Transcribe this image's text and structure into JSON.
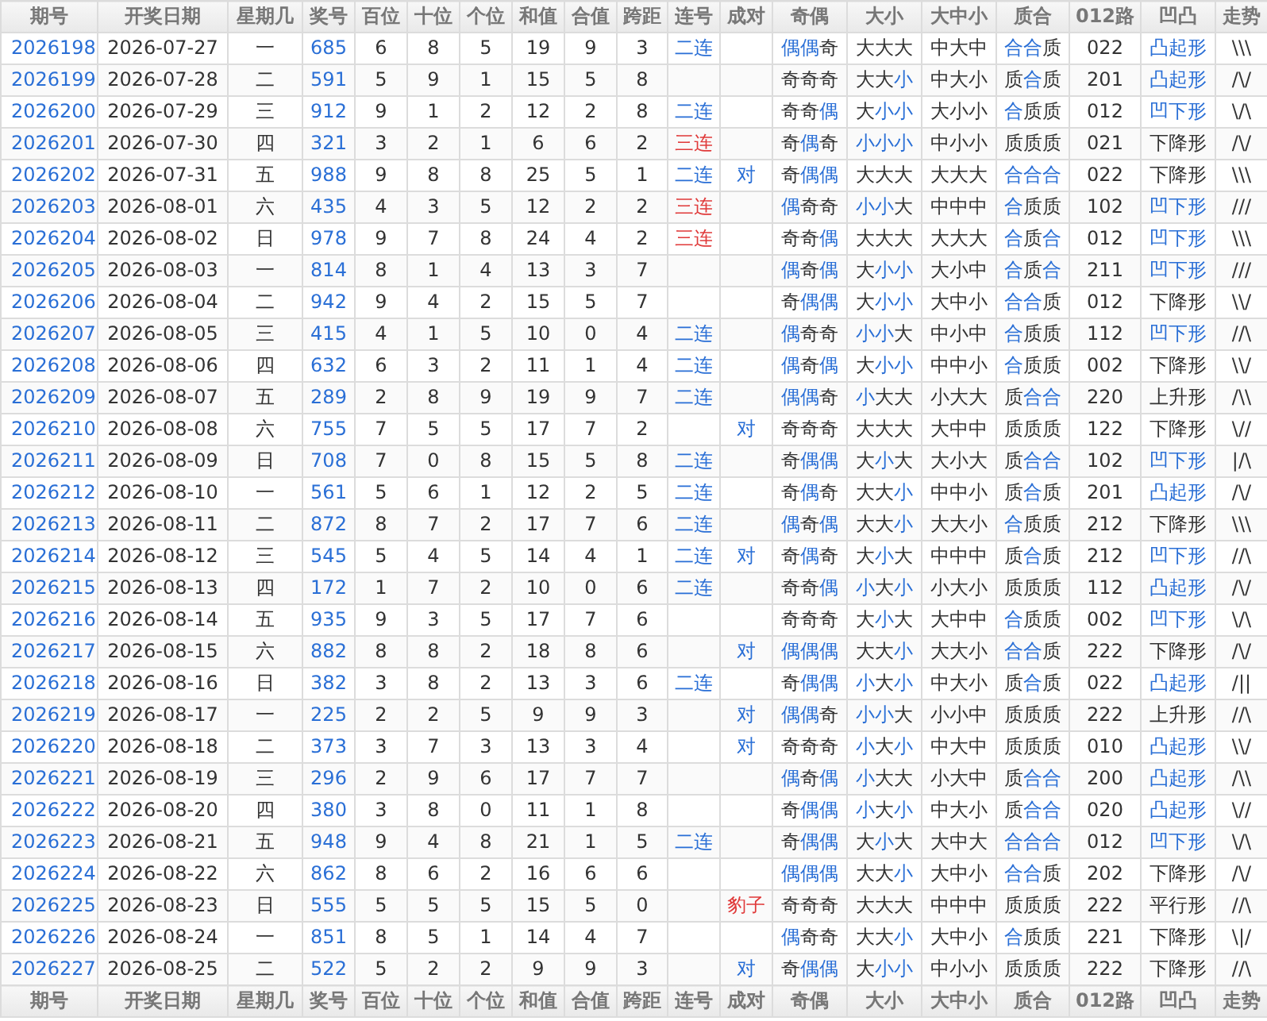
{
  "columns": [
    "期号",
    "开奖日期",
    "星期几",
    "奖号",
    "百位",
    "十位",
    "个位",
    "和值",
    "合值",
    "跨距",
    "连号",
    "成对",
    "奇偶",
    "大小",
    "大中小",
    "质合",
    "012路",
    "凹凸",
    "走势"
  ],
  "rows": [
    {
      "issue": "2026198",
      "date": "2026-07-27",
      "weekday": "一",
      "number": "685",
      "hundreds": "6",
      "tens": "8",
      "units": "5",
      "sum": "19",
      "sum_tail": "9",
      "span": "3",
      "consec": {
        "text": "二连",
        "color": "#2a6fd6"
      },
      "parity": "偶偶奇",
      "parity_hl": [
        true,
        true,
        false
      ],
      "size": "大大大",
      "size_hl": [
        false,
        false,
        false
      ],
      "size3": "中大中",
      "prime": "合合质",
      "prime_hl": [
        true,
        true,
        false
      ],
      "road": "022",
      "shape": "凸起形",
      "shape_hl": true,
      "trend": "\\\\\\"
    },
    {
      "issue": "2026199",
      "date": "2026-07-28",
      "weekday": "二",
      "number": "591",
      "hundreds": "5",
      "tens": "9",
      "units": "1",
      "sum": "15",
      "sum_tail": "5",
      "span": "8",
      "parity": "奇奇奇",
      "parity_hl": [
        false,
        false,
        false
      ],
      "size": "大大小",
      "size_hl": [
        false,
        false,
        true
      ],
      "size3": "中大小",
      "prime": "质合质",
      "prime_hl": [
        false,
        true,
        false
      ],
      "road": "201",
      "shape": "凸起形",
      "shape_hl": true,
      "trend": "/\\/"
    },
    {
      "issue": "2026200",
      "date": "2026-07-29",
      "weekday": "三",
      "number": "912",
      "hundreds": "9",
      "tens": "1",
      "units": "2",
      "sum": "12",
      "sum_tail": "2",
      "span": "8",
      "consec": {
        "text": "二连",
        "color": "#2a6fd6"
      },
      "parity": "奇奇偶",
      "parity_hl": [
        false,
        false,
        true
      ],
      "size": "大小小",
      "size_hl": [
        false,
        true,
        true
      ],
      "size3": "大小小",
      "prime": "合质质",
      "prime_hl": [
        true,
        false,
        false
      ],
      "road": "012",
      "shape": "凹下形",
      "shape_hl": true,
      "trend": "\\/\\"
    },
    {
      "issue": "2026201",
      "date": "2026-07-30",
      "weekday": "四",
      "number": "321",
      "hundreds": "3",
      "tens": "2",
      "units": "1",
      "sum": "6",
      "sum_tail": "6",
      "span": "2",
      "consec": {
        "text": "三连",
        "color": "#e03a3a"
      },
      "parity": "奇偶奇",
      "parity_hl": [
        false,
        true,
        false
      ],
      "size": "小小小",
      "size_hl": [
        true,
        true,
        true
      ],
      "size3": "中小小",
      "prime": "质质质",
      "prime_hl": [
        false,
        false,
        false
      ],
      "road": "021",
      "shape": "下降形",
      "shape_hl": false,
      "trend": "/\\/"
    },
    {
      "issue": "2026202",
      "date": "2026-07-31",
      "weekday": "五",
      "number": "988",
      "hundreds": "9",
      "tens": "8",
      "units": "8",
      "sum": "25",
      "sum_tail": "5",
      "span": "1",
      "consec": {
        "text": "二连",
        "color": "#2a6fd6"
      },
      "pair": {
        "text": "对",
        "color": "#2a6fd6"
      },
      "parity": "奇偶偶",
      "parity_hl": [
        false,
        true,
        true
      ],
      "size": "大大大",
      "size_hl": [
        false,
        false,
        false
      ],
      "size3": "大大大",
      "prime": "合合合",
      "prime_hl": [
        true,
        true,
        true
      ],
      "road": "022",
      "shape": "下降形",
      "shape_hl": false,
      "trend": "\\\\\\"
    },
    {
      "issue": "2026203",
      "date": "2026-08-01",
      "weekday": "六",
      "number": "435",
      "hundreds": "4",
      "tens": "3",
      "units": "5",
      "sum": "12",
      "sum_tail": "2",
      "span": "2",
      "consec": {
        "text": "三连",
        "color": "#e03a3a"
      },
      "parity": "偶奇奇",
      "parity_hl": [
        true,
        false,
        false
      ],
      "size": "小小大",
      "size_hl": [
        true,
        true,
        false
      ],
      "size3": "中中中",
      "prime": "合质质",
      "prime_hl": [
        true,
        false,
        false
      ],
      "road": "102",
      "shape": "凹下形",
      "shape_hl": true,
      "trend": "///"
    },
    {
      "issue": "2026204",
      "date": "2026-08-02",
      "weekday": "日",
      "number": "978",
      "hundreds": "9",
      "tens": "7",
      "units": "8",
      "sum": "24",
      "sum_tail": "4",
      "span": "2",
      "consec": {
        "text": "三连",
        "color": "#e03a3a"
      },
      "parity": "奇奇偶",
      "parity_hl": [
        false,
        false,
        true
      ],
      "size": "大大大",
      "size_hl": [
        false,
        false,
        false
      ],
      "size3": "大大大",
      "prime": "合质合",
      "prime_hl": [
        true,
        false,
        true
      ],
      "road": "012",
      "shape": "凹下形",
      "shape_hl": true,
      "trend": "\\\\\\"
    },
    {
      "issue": "2026205",
      "date": "2026-08-03",
      "weekday": "一",
      "number": "814",
      "hundreds": "8",
      "tens": "1",
      "units": "4",
      "sum": "13",
      "sum_tail": "3",
      "span": "7",
      "parity": "偶奇偶",
      "parity_hl": [
        true,
        false,
        true
      ],
      "size": "大小小",
      "size_hl": [
        false,
        true,
        true
      ],
      "size3": "大小中",
      "prime": "合质合",
      "prime_hl": [
        true,
        false,
        true
      ],
      "road": "211",
      "shape": "凹下形",
      "shape_hl": true,
      "trend": "///"
    },
    {
      "issue": "2026206",
      "date": "2026-08-04",
      "weekday": "二",
      "number": "942",
      "hundreds": "9",
      "tens": "4",
      "units": "2",
      "sum": "15",
      "sum_tail": "5",
      "span": "7",
      "parity": "奇偶偶",
      "parity_hl": [
        false,
        true,
        true
      ],
      "size": "大小小",
      "size_hl": [
        false,
        true,
        true
      ],
      "size3": "大中小",
      "prime": "合合质",
      "prime_hl": [
        true,
        true,
        false
      ],
      "road": "012",
      "shape": "下降形",
      "shape_hl": false,
      "trend": "\\\\/"
    },
    {
      "issue": "2026207",
      "date": "2026-08-05",
      "weekday": "三",
      "number": "415",
      "hundreds": "4",
      "tens": "1",
      "units": "5",
      "sum": "10",
      "sum_tail": "0",
      "span": "4",
      "consec": {
        "text": "二连",
        "color": "#2a6fd6"
      },
      "parity": "偶奇奇",
      "parity_hl": [
        true,
        false,
        false
      ],
      "size": "小小大",
      "size_hl": [
        true,
        true,
        false
      ],
      "size3": "中小中",
      "prime": "合质质",
      "prime_hl": [
        true,
        false,
        false
      ],
      "road": "112",
      "shape": "凹下形",
      "shape_hl": true,
      "trend": "//\\"
    },
    {
      "issue": "2026208",
      "date": "2026-08-06",
      "weekday": "四",
      "number": "632",
      "hundreds": "6",
      "tens": "3",
      "units": "2",
      "sum": "11",
      "sum_tail": "1",
      "span": "4",
      "consec": {
        "text": "二连",
        "color": "#2a6fd6"
      },
      "parity": "偶奇偶",
      "parity_hl": [
        true,
        false,
        true
      ],
      "size": "大小小",
      "size_hl": [
        false,
        true,
        true
      ],
      "size3": "中中小",
      "prime": "合质质",
      "prime_hl": [
        true,
        false,
        false
      ],
      "road": "002",
      "shape": "下降形",
      "shape_hl": false,
      "trend": "\\\\/"
    },
    {
      "issue": "2026209",
      "date": "2026-08-07",
      "weekday": "五",
      "number": "289",
      "hundreds": "2",
      "tens": "8",
      "units": "9",
      "sum": "19",
      "sum_tail": "9",
      "span": "7",
      "consec": {
        "text": "二连",
        "color": "#2a6fd6"
      },
      "parity": "偶偶奇",
      "parity_hl": [
        true,
        true,
        false
      ],
      "size": "小大大",
      "size_hl": [
        true,
        false,
        false
      ],
      "size3": "小大大",
      "prime": "质合合",
      "prime_hl": [
        false,
        true,
        true
      ],
      "road": "220",
      "shape": "上升形",
      "shape_hl": false,
      "trend": "/\\\\"
    },
    {
      "issue": "2026210",
      "date": "2026-08-08",
      "weekday": "六",
      "number": "755",
      "hundreds": "7",
      "tens": "5",
      "units": "5",
      "sum": "17",
      "sum_tail": "7",
      "span": "2",
      "pair": {
        "text": "对",
        "color": "#2a6fd6"
      },
      "parity": "奇奇奇",
      "parity_hl": [
        false,
        false,
        false
      ],
      "size": "大大大",
      "size_hl": [
        false,
        false,
        false
      ],
      "size3": "大中中",
      "prime": "质质质",
      "prime_hl": [
        false,
        false,
        false
      ],
      "road": "122",
      "shape": "下降形",
      "shape_hl": false,
      "trend": "\\//"
    },
    {
      "issue": "2026211",
      "date": "2026-08-09",
      "weekday": "日",
      "number": "708",
      "hundreds": "7",
      "tens": "0",
      "units": "8",
      "sum": "15",
      "sum_tail": "5",
      "span": "8",
      "consec": {
        "text": "二连",
        "color": "#2a6fd6"
      },
      "parity": "奇偶偶",
      "parity_hl": [
        false,
        true,
        true
      ],
      "size": "大小大",
      "size_hl": [
        false,
        true,
        false
      ],
      "size3": "大小大",
      "prime": "质合合",
      "prime_hl": [
        false,
        true,
        true
      ],
      "road": "102",
      "shape": "凹下形",
      "shape_hl": true,
      "trend": "|/\\"
    },
    {
      "issue": "2026212",
      "date": "2026-08-10",
      "weekday": "一",
      "number": "561",
      "hundreds": "5",
      "tens": "6",
      "units": "1",
      "sum": "12",
      "sum_tail": "2",
      "span": "5",
      "consec": {
        "text": "二连",
        "color": "#2a6fd6"
      },
      "parity": "奇偶奇",
      "parity_hl": [
        false,
        true,
        false
      ],
      "size": "大大小",
      "size_hl": [
        false,
        false,
        true
      ],
      "size3": "中中小",
      "prime": "质合质",
      "prime_hl": [
        false,
        true,
        false
      ],
      "road": "201",
      "shape": "凸起形",
      "shape_hl": true,
      "trend": "/\\/"
    },
    {
      "issue": "2026213",
      "date": "2026-08-11",
      "weekday": "二",
      "number": "872",
      "hundreds": "8",
      "tens": "7",
      "units": "2",
      "sum": "17",
      "sum_tail": "7",
      "span": "6",
      "consec": {
        "text": "二连",
        "color": "#2a6fd6"
      },
      "parity": "偶奇偶",
      "parity_hl": [
        true,
        false,
        true
      ],
      "size": "大大小",
      "size_hl": [
        false,
        false,
        true
      ],
      "size3": "大大小",
      "prime": "合质质",
      "prime_hl": [
        true,
        false,
        false
      ],
      "road": "212",
      "shape": "下降形",
      "shape_hl": false,
      "trend": "\\\\\\"
    },
    {
      "issue": "2026214",
      "date": "2026-08-12",
      "weekday": "三",
      "number": "545",
      "hundreds": "5",
      "tens": "4",
      "units": "5",
      "sum": "14",
      "sum_tail": "4",
      "span": "1",
      "consec": {
        "text": "二连",
        "color": "#2a6fd6"
      },
      "pair": {
        "text": "对",
        "color": "#2a6fd6"
      },
      "parity": "奇偶奇",
      "parity_hl": [
        false,
        true,
        false
      ],
      "size": "大小大",
      "size_hl": [
        false,
        true,
        false
      ],
      "size3": "中中中",
      "prime": "质合质",
      "prime_hl": [
        false,
        true,
        false
      ],
      "road": "212",
      "shape": "凹下形",
      "shape_hl": true,
      "trend": "//\\"
    },
    {
      "issue": "2026215",
      "date": "2026-08-13",
      "weekday": "四",
      "number": "172",
      "hundreds": "1",
      "tens": "7",
      "units": "2",
      "sum": "10",
      "sum_tail": "0",
      "span": "6",
      "consec": {
        "text": "二连",
        "color": "#2a6fd6"
      },
      "parity": "奇奇偶",
      "parity_hl": [
        false,
        false,
        true
      ],
      "size": "小大小",
      "size_hl": [
        true,
        false,
        true
      ],
      "size3": "小大小",
      "prime": "质质质",
      "prime_hl": [
        false,
        false,
        false
      ],
      "road": "112",
      "shape": "凸起形",
      "shape_hl": true,
      "trend": "/\\/"
    },
    {
      "issue": "2026216",
      "date": "2026-08-14",
      "weekday": "五",
      "number": "935",
      "hundreds": "9",
      "tens": "3",
      "units": "5",
      "sum": "17",
      "sum_tail": "7",
      "span": "6",
      "parity": "奇奇奇",
      "parity_hl": [
        false,
        false,
        false
      ],
      "size": "大小大",
      "size_hl": [
        false,
        true,
        false
      ],
      "size3": "大中中",
      "prime": "合质质",
      "prime_hl": [
        true,
        false,
        false
      ],
      "road": "002",
      "shape": "凹下形",
      "shape_hl": true,
      "trend": "\\/\\"
    },
    {
      "issue": "2026217",
      "date": "2026-08-15",
      "weekday": "六",
      "number": "882",
      "hundreds": "8",
      "tens": "8",
      "units": "2",
      "sum": "18",
      "sum_tail": "8",
      "span": "6",
      "pair": {
        "text": "对",
        "color": "#2a6fd6"
      },
      "parity": "偶偶偶",
      "parity_hl": [
        true,
        true,
        true
      ],
      "size": "大大小",
      "size_hl": [
        false,
        false,
        true
      ],
      "size3": "大大小",
      "prime": "合合质",
      "prime_hl": [
        true,
        true,
        false
      ],
      "road": "222",
      "shape": "下降形",
      "shape_hl": false,
      "trend": "/\\/"
    },
    {
      "issue": "2026218",
      "date": "2026-08-16",
      "weekday": "日",
      "number": "382",
      "hundreds": "3",
      "tens": "8",
      "units": "2",
      "sum": "13",
      "sum_tail": "3",
      "span": "6",
      "consec": {
        "text": "二连",
        "color": "#2a6fd6"
      },
      "parity": "奇偶偶",
      "parity_hl": [
        false,
        true,
        true
      ],
      "size": "小大小",
      "size_hl": [
        true,
        false,
        true
      ],
      "size3": "中大小",
      "prime": "质合质",
      "prime_hl": [
        false,
        true,
        false
      ],
      "road": "022",
      "shape": "凸起形",
      "shape_hl": true,
      "trend": "/||"
    },
    {
      "issue": "2026219",
      "date": "2026-08-17",
      "weekday": "一",
      "number": "225",
      "hundreds": "2",
      "tens": "2",
      "units": "5",
      "sum": "9",
      "sum_tail": "9",
      "span": "3",
      "pair": {
        "text": "对",
        "color": "#2a6fd6"
      },
      "parity": "偶偶奇",
      "parity_hl": [
        true,
        true,
        false
      ],
      "size": "小小大",
      "size_hl": [
        true,
        true,
        false
      ],
      "size3": "小小中",
      "prime": "质质质",
      "prime_hl": [
        false,
        false,
        false
      ],
      "road": "222",
      "shape": "上升形",
      "shape_hl": false,
      "trend": "//\\"
    },
    {
      "issue": "2026220",
      "date": "2026-08-18",
      "weekday": "二",
      "number": "373",
      "hundreds": "3",
      "tens": "7",
      "units": "3",
      "sum": "13",
      "sum_tail": "3",
      "span": "4",
      "pair": {
        "text": "对",
        "color": "#2a6fd6"
      },
      "parity": "奇奇奇",
      "parity_hl": [
        false,
        false,
        false
      ],
      "size": "小大小",
      "size_hl": [
        true,
        false,
        true
      ],
      "size3": "中大中",
      "prime": "质质质",
      "prime_hl": [
        false,
        false,
        false
      ],
      "road": "010",
      "shape": "凸起形",
      "shape_hl": true,
      "trend": "\\\\/"
    },
    {
      "issue": "2026221",
      "date": "2026-08-19",
      "weekday": "三",
      "number": "296",
      "hundreds": "2",
      "tens": "9",
      "units": "6",
      "sum": "17",
      "sum_tail": "7",
      "span": "7",
      "parity": "偶奇偶",
      "parity_hl": [
        true,
        false,
        true
      ],
      "size": "小大大",
      "size_hl": [
        true,
        false,
        false
      ],
      "size3": "小大中",
      "prime": "质合合",
      "prime_hl": [
        false,
        true,
        true
      ],
      "road": "200",
      "shape": "凸起形",
      "shape_hl": true,
      "trend": "/\\\\"
    },
    {
      "issue": "2026222",
      "date": "2026-08-20",
      "weekday": "四",
      "number": "380",
      "hundreds": "3",
      "tens": "8",
      "units": "0",
      "sum": "11",
      "sum_tail": "1",
      "span": "8",
      "parity": "奇偶偶",
      "parity_hl": [
        false,
        true,
        true
      ],
      "size": "小大小",
      "size_hl": [
        true,
        false,
        true
      ],
      "size3": "中大小",
      "prime": "质合合",
      "prime_hl": [
        false,
        true,
        true
      ],
      "road": "020",
      "shape": "凸起形",
      "shape_hl": true,
      "trend": "\\//"
    },
    {
      "issue": "2026223",
      "date": "2026-08-21",
      "weekday": "五",
      "number": "948",
      "hundreds": "9",
      "tens": "4",
      "units": "8",
      "sum": "21",
      "sum_tail": "1",
      "span": "5",
      "consec": {
        "text": "二连",
        "color": "#2a6fd6"
      },
      "parity": "奇偶偶",
      "parity_hl": [
        false,
        true,
        true
      ],
      "size": "大小大",
      "size_hl": [
        false,
        true,
        false
      ],
      "size3": "大中大",
      "prime": "合合合",
      "prime_hl": [
        true,
        true,
        true
      ],
      "road": "012",
      "shape": "凹下形",
      "shape_hl": true,
      "trend": "\\/\\"
    },
    {
      "issue": "2026224",
      "date": "2026-08-22",
      "weekday": "六",
      "number": "862",
      "hundreds": "8",
      "tens": "6",
      "units": "2",
      "sum": "16",
      "sum_tail": "6",
      "span": "6",
      "parity": "偶偶偶",
      "parity_hl": [
        true,
        true,
        true
      ],
      "size": "大大小",
      "size_hl": [
        false,
        false,
        true
      ],
      "size3": "大中小",
      "prime": "合合质",
      "prime_hl": [
        true,
        true,
        false
      ],
      "road": "202",
      "shape": "下降形",
      "shape_hl": false,
      "trend": "/\\/"
    },
    {
      "issue": "2026225",
      "date": "2026-08-23",
      "weekday": "日",
      "number": "555",
      "hundreds": "5",
      "tens": "5",
      "units": "5",
      "sum": "15",
      "sum_tail": "5",
      "span": "0",
      "pair": {
        "text": "豹子",
        "color": "#e03a3a"
      },
      "parity": "奇奇奇",
      "parity_hl": [
        false,
        false,
        false
      ],
      "size": "大大大",
      "size_hl": [
        false,
        false,
        false
      ],
      "size3": "中中中",
      "prime": "质质质",
      "prime_hl": [
        false,
        false,
        false
      ],
      "road": "222",
      "shape": "平行形",
      "shape_hl": false,
      "trend": "//\\"
    },
    {
      "issue": "2026226",
      "date": "2026-08-24",
      "weekday": "一",
      "number": "851",
      "hundreds": "8",
      "tens": "5",
      "units": "1",
      "sum": "14",
      "sum_tail": "4",
      "span": "7",
      "parity": "偶奇奇",
      "parity_hl": [
        true,
        false,
        false
      ],
      "size": "大大小",
      "size_hl": [
        false,
        false,
        true
      ],
      "size3": "大中小",
      "prime": "合质质",
      "prime_hl": [
        true,
        false,
        false
      ],
      "road": "221",
      "shape": "下降形",
      "shape_hl": false,
      "trend": "\\|/"
    },
    {
      "issue": "2026227",
      "date": "2026-08-25",
      "weekday": "二",
      "number": "522",
      "hundreds": "5",
      "tens": "2",
      "units": "2",
      "sum": "9",
      "sum_tail": "9",
      "span": "3",
      "pair": {
        "text": "对",
        "color": "#2a6fd6"
      },
      "parity": "奇偶偶",
      "parity_hl": [
        false,
        true,
        true
      ],
      "size": "大小小",
      "size_hl": [
        false,
        true,
        true
      ],
      "size3": "中小小",
      "prime": "质质质",
      "prime_hl": [
        false,
        false,
        false
      ],
      "road": "222",
      "shape": "下降形",
      "shape_hl": false,
      "trend": "//\\"
    }
  ],
  "footer_columns": [
    "期号",
    "开奖日期",
    "星期几",
    "奖号",
    "百位",
    "十位",
    "个位",
    "和值",
    "合值",
    "跨距",
    "连号",
    "成对",
    "奇偶",
    "大小",
    "大中小",
    "质合",
    "012路",
    "凹凸",
    "走势"
  ]
}
